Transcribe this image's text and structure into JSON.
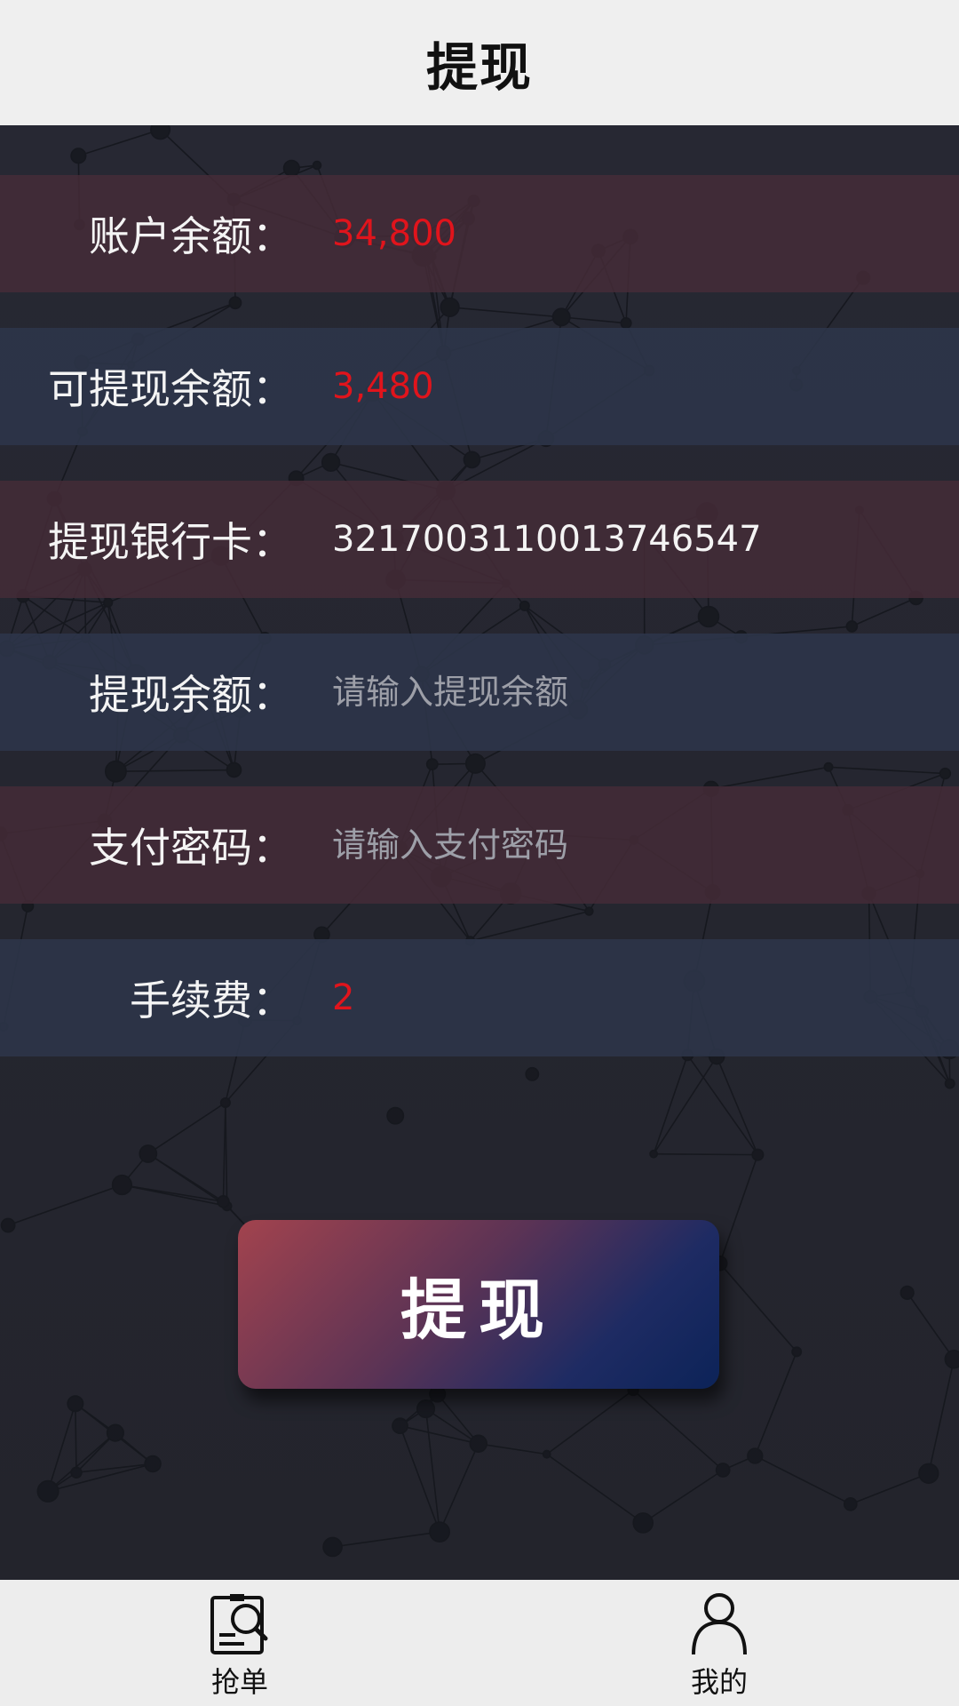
{
  "header": {
    "title": "提现"
  },
  "form": {
    "balance": {
      "label": "账户余额：",
      "value": "34,800"
    },
    "withdrawable": {
      "label": "可提现余额：",
      "value": "3,480"
    },
    "bank_card": {
      "label": "提现银行卡：",
      "value": "3217003110013746547"
    },
    "amount": {
      "label": "提现余额：",
      "placeholder": "请输入提现余额"
    },
    "password": {
      "label": "支付密码：",
      "placeholder": "请输入支付密码"
    },
    "fee": {
      "label": "手续费：",
      "value": "2"
    }
  },
  "submit_label": "提现",
  "tabbar": {
    "items": [
      {
        "label": "抢单",
        "icon": "order-search-icon"
      },
      {
        "label": "我的",
        "icon": "user-icon"
      }
    ]
  },
  "colors": {
    "accent_red": "#e0141c",
    "button_start": "#a2434e",
    "button_end": "#0c2358",
    "row_red": "#462c38",
    "row_blue": "#2e364a"
  }
}
